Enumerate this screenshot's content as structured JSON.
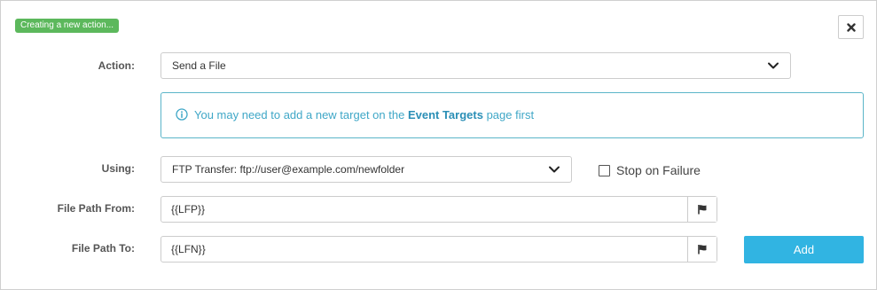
{
  "status_badge": "Creating a new action...",
  "form": {
    "action_label": "Action:",
    "action_value": "Send a File",
    "info": {
      "prefix": "You may need to add a new target on the",
      "link": "Event Targets",
      "suffix": "page first"
    },
    "using_label": "Using:",
    "using_value": "FTP Transfer: ftp://user@example.com/newfolder",
    "stop_on_failure_label": "Stop on Failure",
    "stop_on_failure_checked": false,
    "file_path_from_label": "File Path From:",
    "file_path_from_value": "{{LFP}}",
    "file_path_to_label": "File Path To:",
    "file_path_to_value": "{{LFN}}",
    "add_button": "Add"
  },
  "icons": {
    "close": "close-icon",
    "chevron": "chevron-down-icon",
    "info": "info-circle-icon",
    "flag": "flag-icon"
  },
  "colors": {
    "status_badge": "#5cb85c",
    "info_border": "#5bb5c9",
    "info_text": "#3fa7c7",
    "add_button": "#31b4e2"
  }
}
